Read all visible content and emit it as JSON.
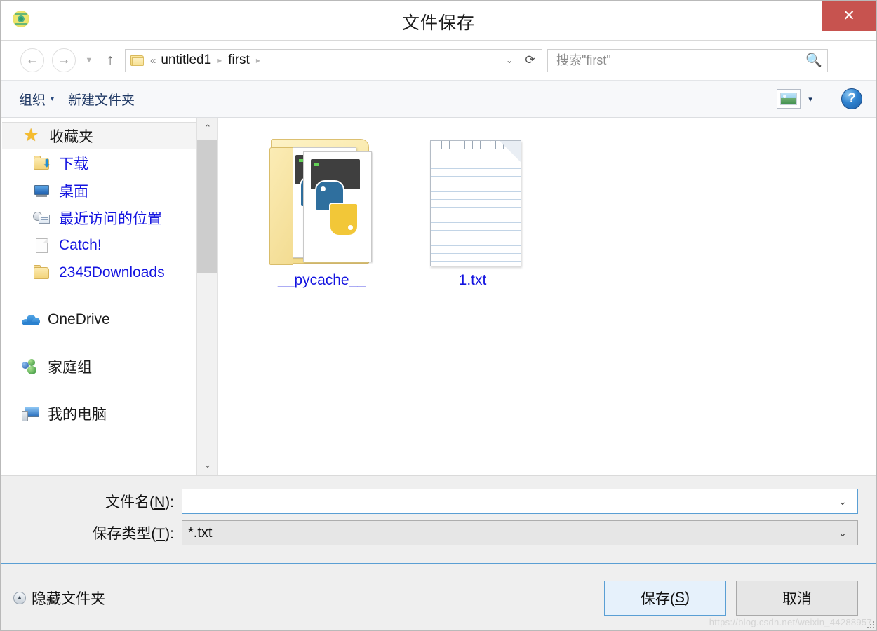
{
  "window": {
    "title": "文件保存",
    "app_icon": "python-idle-icon",
    "close_label": "✕",
    "close_color": "#c7534f"
  },
  "navbar": {
    "back_icon": "back-arrow-icon",
    "forward_icon": "forward-arrow-icon",
    "recent_icon": "chevron-down-icon",
    "up_icon": "up-arrow-icon",
    "folder_icon": "folder-icon",
    "crumb_lead": "«",
    "breadcrumbs": [
      {
        "label": "untitled1"
      },
      {
        "label": "first"
      }
    ],
    "crumb_separator": "▸",
    "dropdown_icon": "chevron-down-icon",
    "refresh_icon": "refresh-icon",
    "search": {
      "placeholder": "搜索\"first\"",
      "value": "",
      "icon": "search-icon"
    }
  },
  "toolbar": {
    "organize_label": "组织",
    "organize_caret": "▾",
    "new_folder_label": "新建文件夹",
    "view_icon": "picture-view-icon",
    "view_caret": "▾",
    "help_label": "?"
  },
  "sidebar": {
    "groups": [
      {
        "header": {
          "label": "收藏夹",
          "icon": "star-icon",
          "selected": true
        },
        "items": [
          {
            "label": "下载",
            "icon": "downloads-folder-icon"
          },
          {
            "label": "桌面",
            "icon": "desktop-monitor-icon"
          },
          {
            "label": "最近访问的位置",
            "icon": "recent-places-icon"
          },
          {
            "label": "Catch!",
            "icon": "document-icon"
          },
          {
            "label": "2345Downloads",
            "icon": "folder-icon"
          }
        ]
      },
      {
        "header": {
          "label": "OneDrive",
          "icon": "onedrive-cloud-icon",
          "selected": false
        },
        "items": []
      },
      {
        "header": {
          "label": "家庭组",
          "icon": "homegroup-icon",
          "selected": false
        },
        "items": []
      },
      {
        "header": {
          "label": "我的电脑",
          "icon": "my-computer-icon",
          "selected": false
        },
        "items": []
      }
    ],
    "scrollbar": {
      "up_icon": "chevron-up-icon",
      "down_icon": "chevron-down-icon"
    }
  },
  "files": [
    {
      "name": "__pycache__",
      "icon": "python-cache-folder-icon",
      "type": "folder"
    },
    {
      "name": "1.txt",
      "icon": "text-document-icon",
      "type": "file"
    }
  ],
  "form": {
    "filename": {
      "label_prefix": "文件名(",
      "label_key": "N",
      "label_suffix": "):",
      "value": "",
      "placeholder": "",
      "chevron": "⌄"
    },
    "filetype": {
      "label_prefix": "保存类型(",
      "label_key": "T",
      "label_suffix": "):",
      "value": "*.txt",
      "chevron": "⌄"
    }
  },
  "footer": {
    "hide_folders_label": "隐藏文件夹",
    "hide_folders_icon": "collapse-up-icon",
    "save": {
      "prefix": "保存(",
      "key": "S",
      "suffix": ")"
    },
    "cancel_label": "取消"
  },
  "watermark": "https://blog.csdn.net/weixin_44288957"
}
